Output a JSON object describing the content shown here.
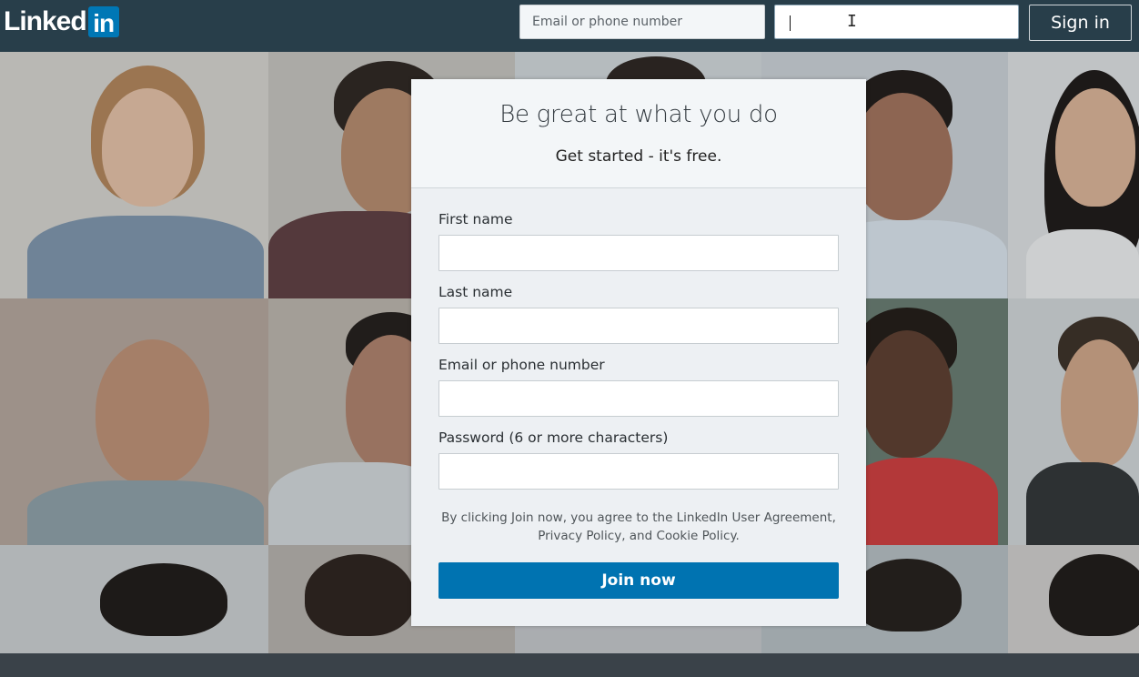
{
  "header": {
    "logo_text": "Linked",
    "logo_badge": "in",
    "email_placeholder": "Email or phone number",
    "password_value": "",
    "sign_in_label": "Sign in"
  },
  "card": {
    "title": "Be great at what you do",
    "subtitle": "Get started - it's free.",
    "fields": [
      {
        "label": "First name"
      },
      {
        "label": "Last name"
      },
      {
        "label": "Email or phone number"
      },
      {
        "label": "Password (6 or more characters)"
      }
    ],
    "legal_prefix": "By clicking Join now, you agree to the LinkedIn ",
    "legal_user_agreement": "User Agreement",
    "legal_comma": ",",
    "legal_privacy": "Privacy Policy",
    "legal_and": ", and ",
    "legal_cookie": "Cookie Policy",
    "legal_end": ".",
    "join_label": "Join now"
  },
  "colors": {
    "header_bg": "#283e4a",
    "brand_blue": "#0073b1",
    "card_bg": "#edf0f3"
  }
}
